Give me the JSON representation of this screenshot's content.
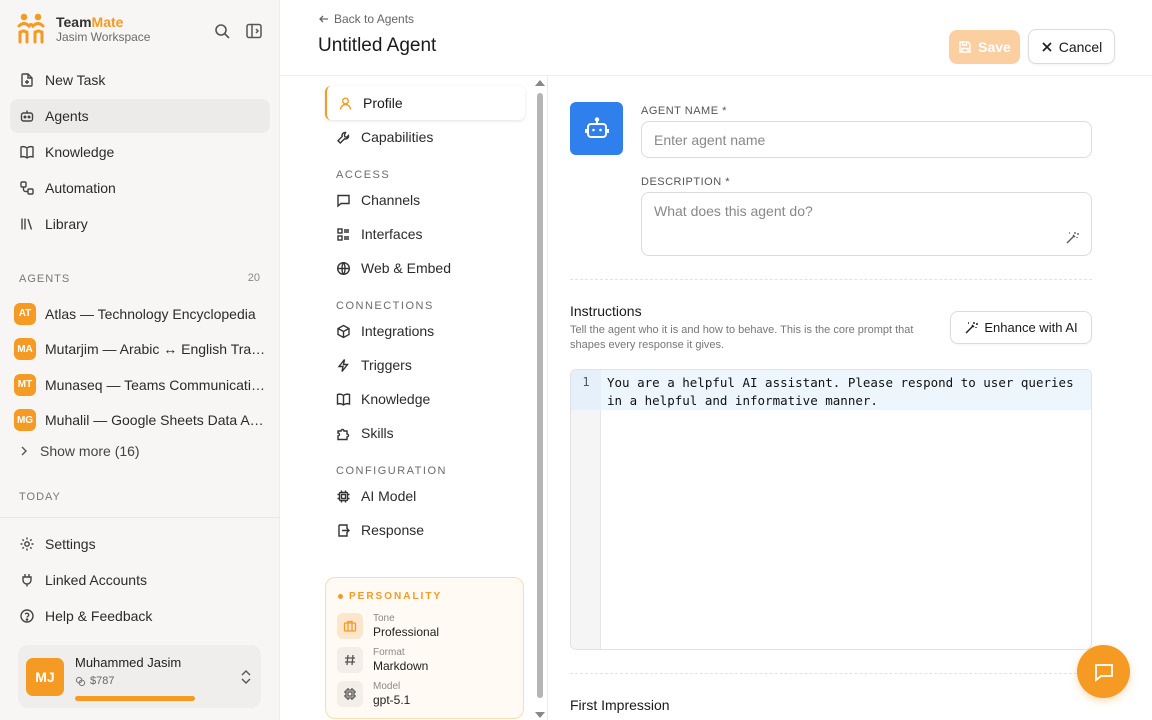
{
  "brand": {
    "name_part1": "Team",
    "name_part2": "Mate",
    "workspace": "Jasim Workspace"
  },
  "sidebar": {
    "nav": [
      {
        "label": "New Task",
        "icon": "new-task-icon"
      },
      {
        "label": "Agents",
        "icon": "robot-icon",
        "active": true
      },
      {
        "label": "Knowledge",
        "icon": "book-icon"
      },
      {
        "label": "Automation",
        "icon": "workflow-icon"
      },
      {
        "label": "Library",
        "icon": "library-icon"
      }
    ],
    "agents_heading": "AGENTS",
    "agents_count": "20",
    "agents": [
      {
        "initials": "AT",
        "name": "Atlas — Technology Encyclopedia"
      },
      {
        "initials": "MA",
        "name": "Mutarjim — Arabic ↔ English Transl..."
      },
      {
        "initials": "MT",
        "name": "Munaseq — Teams Communicatio..."
      },
      {
        "initials": "MG",
        "name": "Muhalil — Google Sheets Data Ana..."
      }
    ],
    "show_more": "Show more (16)",
    "today_heading": "TODAY",
    "footer_nav": [
      {
        "label": "Settings",
        "icon": "gear-icon"
      },
      {
        "label": "Linked Accounts",
        "icon": "plug-icon"
      },
      {
        "label": "Help & Feedback",
        "icon": "help-icon"
      }
    ],
    "user": {
      "initials": "MJ",
      "name": "Muhammed Jasim",
      "credit": "$787"
    }
  },
  "header": {
    "back": "Back to Agents",
    "title": "Untitled Agent",
    "save": "Save",
    "cancel": "Cancel"
  },
  "settings_nav": {
    "profile": "Profile",
    "capabilities": "Capabilities",
    "access_heading": "ACCESS",
    "channels": "Channels",
    "interfaces": "Interfaces",
    "web_embed": "Web & Embed",
    "connections_heading": "CONNECTIONS",
    "integrations": "Integrations",
    "triggers": "Triggers",
    "knowledge": "Knowledge",
    "skills": "Skills",
    "configuration_heading": "CONFIGURATION",
    "ai_model": "AI Model",
    "response": "Response"
  },
  "personality": {
    "title": "PERSONALITY",
    "tone_label": "Tone",
    "tone_value": "Professional",
    "format_label": "Format",
    "format_value": "Markdown",
    "model_label": "Model",
    "model_value": "gpt-5.1"
  },
  "form": {
    "agent_name_label": "AGENT NAME *",
    "agent_name_placeholder": "Enter agent name",
    "description_label": "DESCRIPTION *",
    "description_placeholder": "What does this agent do?",
    "instructions_title": "Instructions",
    "instructions_desc": "Tell the agent who it is and how to behave. This is the core prompt that shapes every response it gives.",
    "enhance": "Enhance with AI",
    "line_number": "1",
    "instructions_text": "You are a helpful AI assistant. Please respond to user queries in a helpful and informative manner.",
    "first_impression": "First Impression"
  },
  "colors": {
    "accent": "#f59a23",
    "robot_bg": "#2f80ed",
    "save_disabled": "#fbcfa0"
  }
}
